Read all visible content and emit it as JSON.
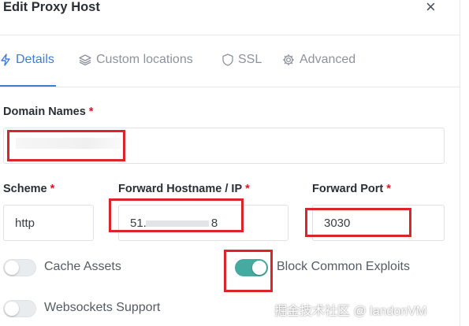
{
  "dialog": {
    "title": "Edit Proxy Host",
    "close_label": "×"
  },
  "tabs": [
    {
      "label": "Details",
      "icon": "bolt-icon",
      "active": true
    },
    {
      "label": "Custom locations",
      "icon": "layers-icon",
      "active": false
    },
    {
      "label": "SSL",
      "icon": "shield-icon",
      "active": false
    },
    {
      "label": "Advanced",
      "icon": "gear-icon",
      "active": false
    }
  ],
  "form": {
    "domain_names": {
      "label": "Domain Names",
      "required_mark": "*",
      "value": ""
    },
    "scheme": {
      "label": "Scheme",
      "required_mark": "*",
      "value": "http"
    },
    "forward_host": {
      "label": "Forward Hostname / IP",
      "required_mark": "*",
      "value": "51.",
      "value_tail": "8"
    },
    "forward_port": {
      "label": "Forward Port",
      "required_mark": "*",
      "value": "3030"
    }
  },
  "toggles": [
    {
      "label": "Cache Assets",
      "on": false
    },
    {
      "label": "Block Common Exploits",
      "on": true
    },
    {
      "label": "Websockets Support",
      "on": false
    }
  ],
  "watermark": "掘金技术社区 @ landonVM",
  "colors": {
    "accent": "#3f7bd8",
    "toggle_on": "#45aaa0",
    "required": "#cd201f",
    "annotation": "#d9262b"
  }
}
